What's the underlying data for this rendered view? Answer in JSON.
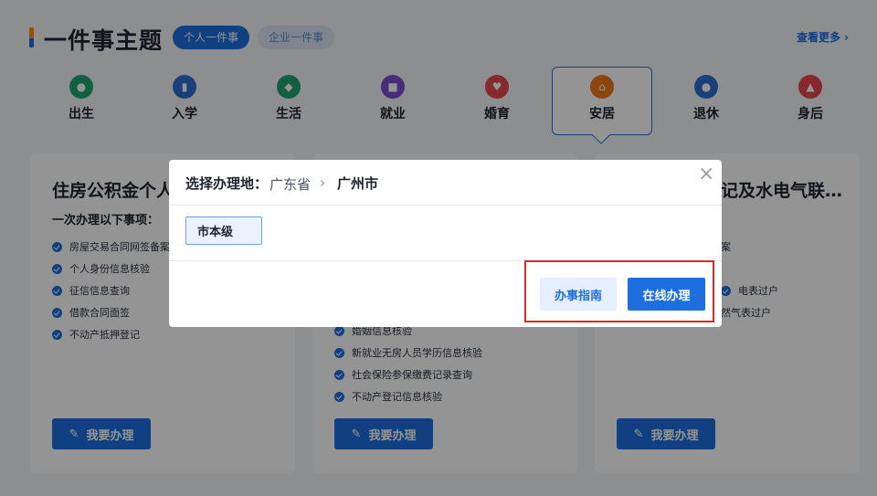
{
  "header": {
    "title": "一件事主题",
    "tabs": [
      {
        "label": "个人一件事",
        "active": true
      },
      {
        "label": "企业一件事",
        "active": false
      }
    ],
    "more_link": "查看更多 ›"
  },
  "categories": [
    {
      "label": "出生",
      "icon": "baby-icon",
      "color": "#1fa672"
    },
    {
      "label": "入学",
      "icon": "book-icon",
      "color": "#2f6fd1"
    },
    {
      "label": "生活",
      "icon": "life-icon",
      "color": "#1fa672"
    },
    {
      "label": "就业",
      "icon": "briefcase-icon",
      "color": "#7b4fd1"
    },
    {
      "label": "婚育",
      "icon": "heart-icon",
      "color": "#e5484d"
    },
    {
      "label": "安居",
      "icon": "home-icon",
      "color": "#f07a1a",
      "active": true
    },
    {
      "label": "退休",
      "icon": "elder-icon",
      "color": "#2f6fd1"
    },
    {
      "label": "身后",
      "icon": "memorial-icon",
      "color": "#e5484d"
    }
  ],
  "cards": [
    {
      "title": "住房公积金个人",
      "subtitle": "一次办理以下事项：",
      "items": [
        "房屋交易合同网签备案",
        "个人身份信息核验",
        "征信信息查询",
        "借款合同面签",
        "不动产抵押登记"
      ],
      "button": "我要办理"
    },
    {
      "items": [
        "婚姻信息核验",
        "新就业无房人员学历信息核验",
        "社会保险参保缴费记录查询",
        "不动产登记信息核验"
      ],
      "button": "我要办理"
    },
    {
      "title": "记及水电气联…",
      "items": [
        "案",
        "电表过户",
        "然气表过户"
      ],
      "button": "我要办理"
    }
  ],
  "modal": {
    "label": "选择办理地：",
    "province": "广东省",
    "separator": "›",
    "city": "广州市",
    "close": "×",
    "level": "市本级",
    "guide_button": "办事指南",
    "online_button": "在线办理"
  },
  "colors": {
    "primary": "#1d6fe0",
    "highlight": "#e0262b"
  }
}
